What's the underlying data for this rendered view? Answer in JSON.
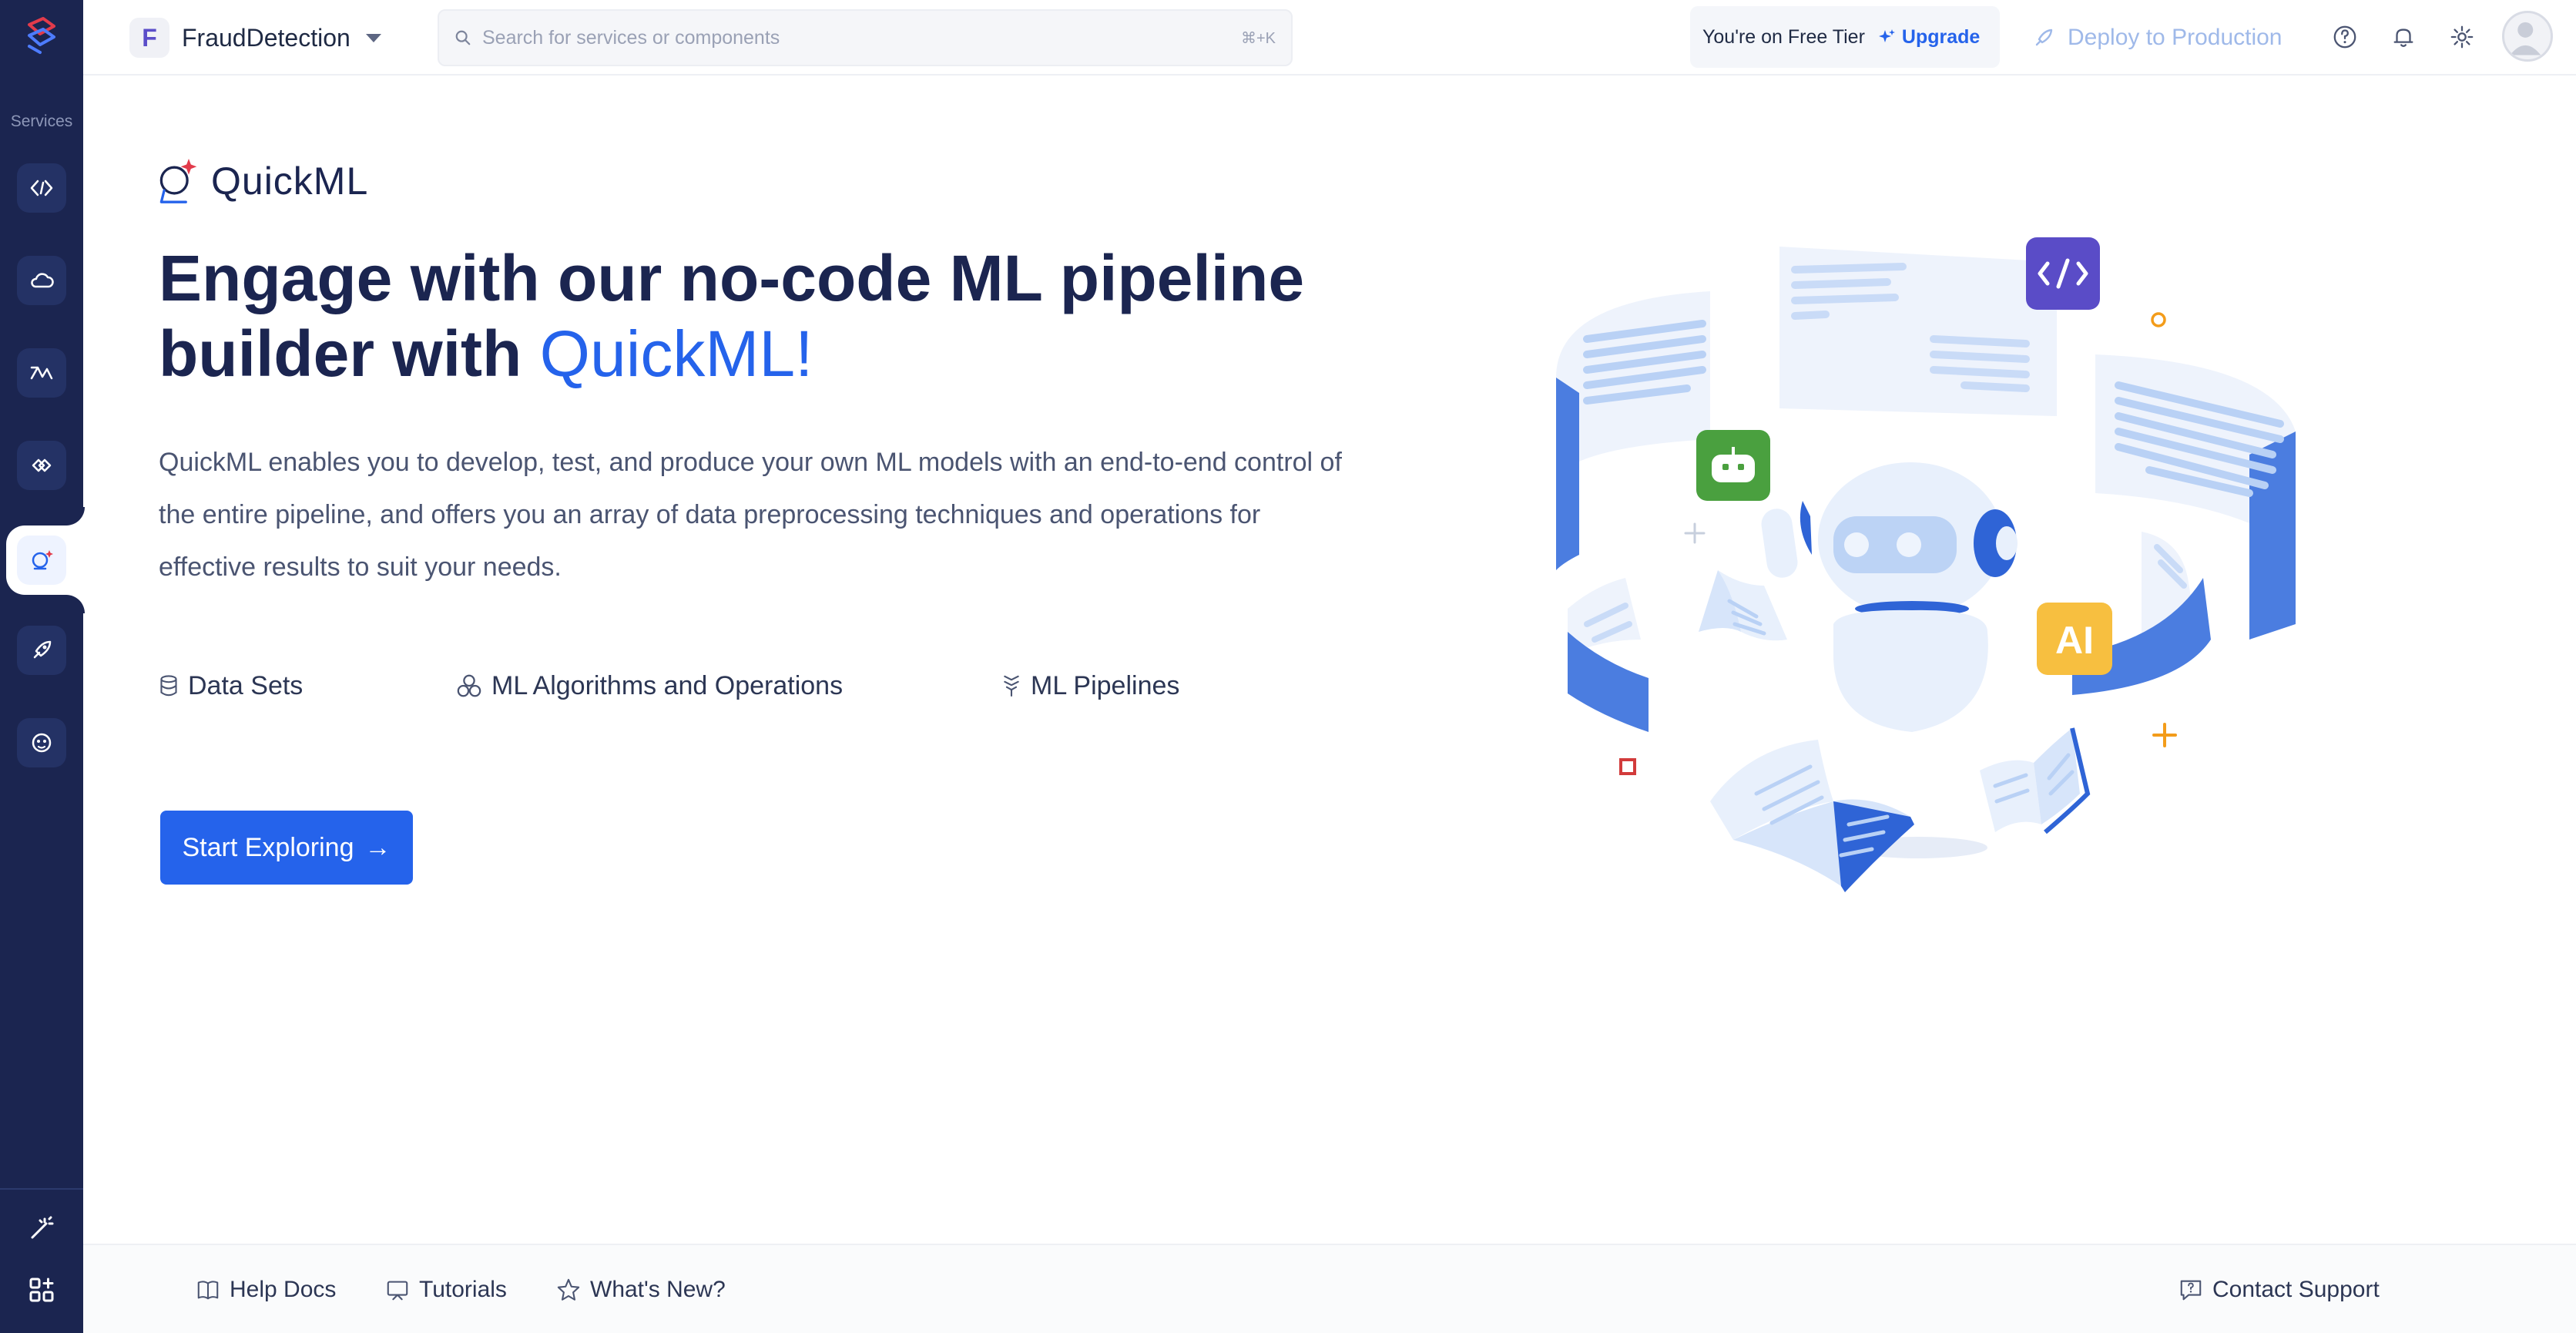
{
  "sidebar": {
    "section_label": "Services",
    "items": [
      {
        "icon": "code-brackets-icon"
      },
      {
        "icon": "cloud-icon"
      },
      {
        "icon": "analytics-icon"
      },
      {
        "icon": "exchange-icon"
      },
      {
        "icon": "quickml-icon",
        "active": true
      },
      {
        "icon": "rocket-icon"
      },
      {
        "icon": "bot-face-icon"
      }
    ],
    "bottom_items": [
      {
        "icon": "magic-wand-icon"
      },
      {
        "icon": "apps-add-icon"
      }
    ]
  },
  "header": {
    "project_initial": "F",
    "project_name": "FraudDetection",
    "search_placeholder": "Search for services or components",
    "search_shortcut": "⌘+K",
    "tier_text": "You're on Free Tier",
    "upgrade_label": "Upgrade",
    "deploy_label": "Deploy to Production"
  },
  "main": {
    "brand_name": "QuickML",
    "headline_part1": "Engage with our no-code ML pipeline builder with ",
    "headline_highlight": "QuickML!",
    "description": "QuickML enables you to develop, test, and produce your own ML models with an end-to-end control of the entire pipeline, and offers you an array of data preprocessing techniques and operations for effective results to suit your needs.",
    "features": [
      {
        "icon": "database-icon",
        "label": "Data Sets"
      },
      {
        "icon": "algorithm-icon",
        "label": "ML Algorithms and Operations"
      },
      {
        "icon": "pipeline-icon",
        "label": "ML Pipelines"
      }
    ],
    "cta_label": "Start Exploring",
    "cta_arrow": "→",
    "illustration_badge_ai": "AI"
  },
  "footer": {
    "help_docs": "Help Docs",
    "tutorials": "Tutorials",
    "whats_new": "What's New?",
    "contact_support": "Contact Support"
  },
  "colors": {
    "sidebar_bg": "#1b2550",
    "accent": "#2563eb",
    "highlight": "#ffd426",
    "heading": "#1b2550"
  }
}
